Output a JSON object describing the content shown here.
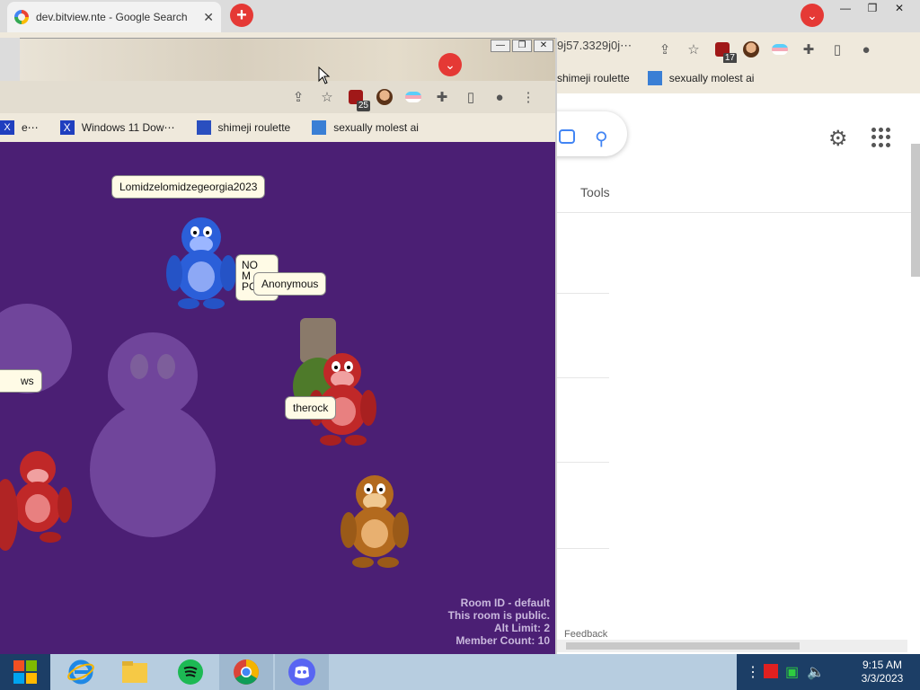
{
  "background_browser": {
    "tab_title": "dev.bitview.nte - Google Search",
    "url_fragment": "9j57.3329j0j⋯",
    "extension_badge": "17",
    "bookmarks": [
      "shimeji roulette",
      "sexually molest ai"
    ],
    "tools_label": "Tools",
    "feedback_label": "Feedback"
  },
  "foreground_browser": {
    "extension_badge": "25",
    "bookmarks": [
      "Windows 11 Dow⋯",
      "shimeji roulette",
      "sexually molest ai"
    ],
    "bookmark_partial": "e⋯"
  },
  "room": {
    "usernames": [
      "Lomidzelomidzegeorgia2023",
      "Anonymous",
      "therock",
      "ws"
    ],
    "speech_text": [
      "NO",
      "M",
      "PC"
    ],
    "info": [
      "Room ID - default",
      "This room is public.",
      "Alt Limit: 2",
      "Member Count: 10"
    ]
  },
  "taskbar": {
    "time": "9:15 AM",
    "date": "3/3/2023"
  },
  "colors": {
    "stage_purple": "#4b1f74",
    "accent_red": "#e53935",
    "google_blue": "#4285f4",
    "taskbar": "#b7cde0"
  }
}
